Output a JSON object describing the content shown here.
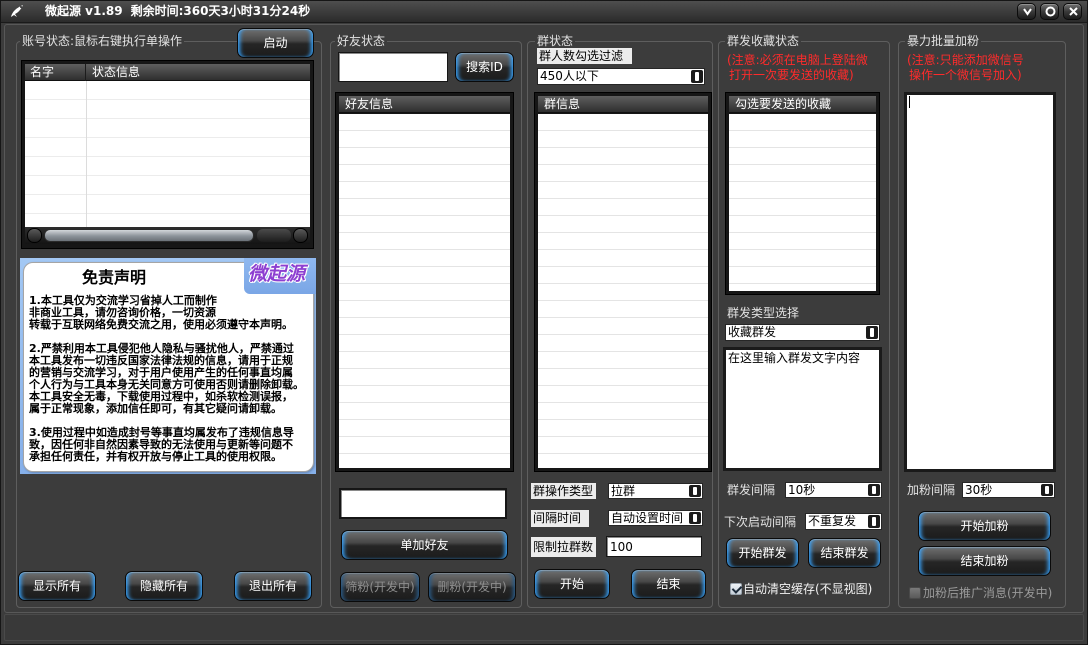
{
  "window": {
    "title": "微起源 v1.89",
    "remaining_time": "剩余时间:360天3小时31分24秒",
    "controls": [
      "minimize-icon",
      "maximize-icon",
      "close-icon"
    ]
  },
  "account": {
    "label": "账号状态:鼠标右键执行单操作",
    "start_button": "启动",
    "columns": [
      "名字",
      "状态信息"
    ],
    "rows": [],
    "show_all_button": "显示所有",
    "hide_all_button": "隐藏所有",
    "exit_all_button": "退出所有"
  },
  "disclaimer": {
    "title": "免责声明",
    "logo": "微起源",
    "paragraphs": [
      [
        "1.本工具仅为交流学习省掉人工而制作",
        "非商业工具，请勿咨询价格，一切资源",
        "转载于互联网络免费交流之用，使用必须遵守本声明。"
      ],
      [
        "2.严禁利用本工具侵犯他人隐私与骚扰他人，严禁通过",
        "本工具发布一切违反国家法律法规的信息，请用于正规",
        "的营销与交流学习，对于用户使用产生的任何事直均属",
        "个人行为与工具本身无关同意方可使用否则请删除卸载。",
        "本工具安全无毒，下载使用过程中，如杀软检测误报，",
        "属于正常现象，添加信任即可，有其它疑问请卸载。"
      ],
      [
        "3.使用过程中如造成封号等事直均属发布了违规信息导",
        "致，因任何非自然因素导致的无法使用与更新等问题不",
        "承担任何责任，并有权开放与停止工具的使用权限。"
      ]
    ]
  },
  "friends": {
    "label": "好友状态",
    "search_value": "",
    "search_button": "搜索ID",
    "list_header": "好友信息",
    "items": [],
    "add_value": "",
    "add_button": "单加好友",
    "filter_button": "筛粉(开发中)",
    "delete_button": "删粉(开发中)"
  },
  "groups": {
    "label": "群状态",
    "member_filter_label": "群人数勾选过滤",
    "member_filter_value": "450人以下",
    "list_header": "群信息",
    "items": [],
    "operation_type_label": "群操作类型",
    "operation_type_value": "拉群",
    "interval_label": "间隔时间",
    "interval_value": "自动设置时间",
    "limit_label": "限制拉群数",
    "limit_value": "100",
    "start_button": "开始",
    "end_button": "结束"
  },
  "broadcast": {
    "label": "群发收藏状态",
    "note_lines": [
      "(注意:必须在电脑上登陆微",
      "打开一次要发送的收藏)"
    ],
    "list_header": "勾选要发送的收藏",
    "items": [],
    "type_label": "群发类型选择",
    "type_value": "收藏群发",
    "message_value": "在这里输入群发文字内容",
    "interval_label": "群发间隔",
    "interval_value": "10秒",
    "next_interval_label": "下次启动间隔",
    "next_interval_value": "不重复发",
    "start_button": "开始群发",
    "end_button": "结束群发",
    "auto_clear_label": "自动清空缓存(不显视图)",
    "auto_clear_checked": true
  },
  "bulk_add": {
    "label": "暴力批量加粉",
    "note_lines": [
      "(注意:只能添加微信号",
      "操作一个微信号加入)"
    ],
    "ids_value": "",
    "interval_label": "加粉间隔",
    "interval_value": "30秒",
    "start_button": "开始加粉",
    "end_button": "结束加粉",
    "promo_label": "加粉后推广消息(开发中)",
    "promo_checked": false
  },
  "colors": {
    "background": "#3c3c3c",
    "button_glow": "#3aa6ff",
    "note_red": "#ff2b2b",
    "disclaimer_bg": "#86b0ea",
    "logo_purple": "#8d3fd1"
  }
}
